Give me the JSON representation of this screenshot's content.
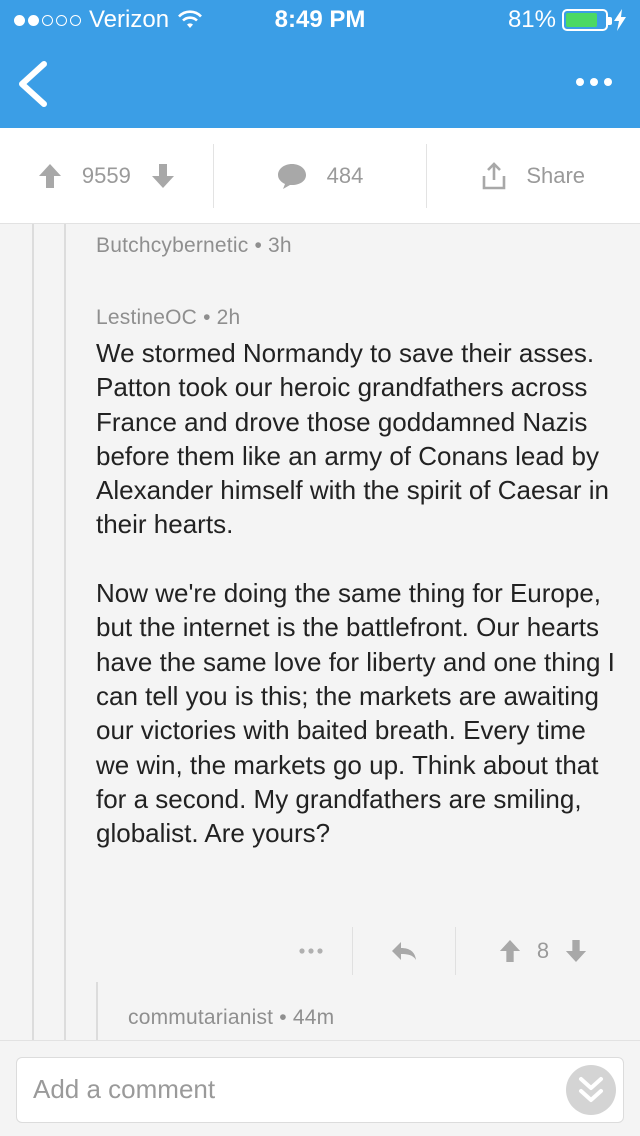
{
  "status_bar": {
    "carrier": "Verizon",
    "time": "8:49 PM",
    "battery": "81%",
    "battery_level": 0.81,
    "signal_bars_filled": 2,
    "signal_bars_total": 5
  },
  "nav": {
    "back_icon": "chevron-left-icon",
    "more_icon": "ellipsis-icon"
  },
  "post_actions": {
    "upvote_count": "9559",
    "comment_count": "484",
    "share_label": "Share"
  },
  "thread": {
    "parent_comment": {
      "author": "Butchcybernetic",
      "age": "3h"
    },
    "comment": {
      "author": "LestineOC",
      "age": "2h",
      "body": "We stormed Normandy to save their asses. Patton took our heroic grandfathers across France and drove those goddamned Nazis before them like an army of Conans lead by Alexander himself with the spirit of Caesar in their hearts.\n\nNow we're doing the same thing for Europe, but the internet is the battlefront. Our hearts have the same love for liberty and one thing I can tell you is this; the markets are awaiting our victories with baited breath. Every time we win, the markets go up. Think about that for a second. My grandfathers are smiling, globalist. Are yours?",
      "score": "8"
    },
    "reply": {
      "author": "commutarianist",
      "age": "44m"
    }
  },
  "comment_bar": {
    "placeholder": "Add a comment"
  },
  "colors": {
    "accent": "#3b9ee6",
    "battery": "#4cd964",
    "muted": "#9a9a9a"
  }
}
